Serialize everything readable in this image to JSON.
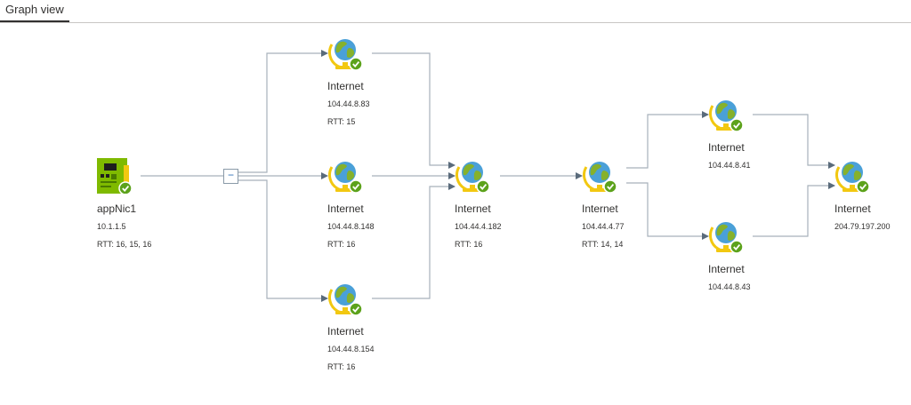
{
  "tabs": [
    {
      "label": "Graph view"
    }
  ],
  "colors": {
    "edge": "#a6b1bb",
    "arrow": "#5a6b7b",
    "globe_water": "#4aa0d8",
    "globe_land": "#86b12c",
    "stand": "#f2c811",
    "check": "#5ca21b",
    "nic_board": "#7fba00"
  },
  "collapse_button": {
    "symbol": "−"
  },
  "nodes": {
    "appnic": {
      "name": "appNic1",
      "ip": "10.1.1.5",
      "rtt": "RTT: 16, 15, 16",
      "icon": "network-interface-icon"
    },
    "hop1a": {
      "name": "Internet",
      "ip": "104.44.8.83",
      "rtt": "RTT: 15",
      "icon": "globe-icon"
    },
    "hop1b": {
      "name": "Internet",
      "ip": "104.44.8.148",
      "rtt": "RTT: 16",
      "icon": "globe-icon"
    },
    "hop1c": {
      "name": "Internet",
      "ip": "104.44.8.154",
      "rtt": "RTT: 16",
      "icon": "globe-icon"
    },
    "hop2": {
      "name": "Internet",
      "ip": "104.44.4.182",
      "rtt": "RTT: 16",
      "icon": "globe-icon"
    },
    "hop3": {
      "name": "Internet",
      "ip": "104.44.4.77",
      "rtt": "RTT: 14, 14",
      "icon": "globe-icon"
    },
    "hop4a": {
      "name": "Internet",
      "ip": "104.44.8.41",
      "icon": "globe-icon"
    },
    "hop4b": {
      "name": "Internet",
      "ip": "104.44.8.43",
      "icon": "globe-icon"
    },
    "dest": {
      "name": "Internet",
      "ip": "204.79.197.200",
      "icon": "globe-icon"
    }
  }
}
